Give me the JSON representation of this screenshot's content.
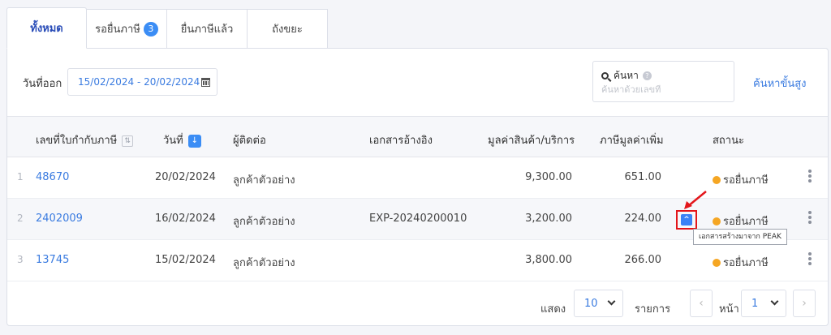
{
  "tabs": [
    {
      "label": "ทั้งหมด"
    },
    {
      "label": "รอยื่นภาษี",
      "badge": "3"
    },
    {
      "label": "ยื่นภาษีแล้ว"
    },
    {
      "label": "ถังขยะ"
    }
  ],
  "filter": {
    "date_label": "วันที่ออก",
    "date_range": "15/02/2024 - 20/02/2024"
  },
  "search": {
    "title": "ค้นหา",
    "help": "?",
    "placeholder": "ค้นหาด้วยเลขที่",
    "advanced_label": "ค้นหาขั้นสูง"
  },
  "table": {
    "headers": {
      "tax_invoice_no": "เลขที่ใบกำกับภาษี",
      "date": "วันที่",
      "contact": "ผู้ติดต่อ",
      "reference": "เอกสารอ้างอิง",
      "amount": "มูลค่าสินค้า/บริการ",
      "vat": "ภาษีมูลค่าเพิ่ม",
      "status": "สถานะ"
    },
    "rows": [
      {
        "index": "1",
        "doc_no": "48670",
        "date": "20/02/2024",
        "contact": "ลูกค้าตัวอย่าง",
        "reference": "",
        "amount": "9,300.00",
        "vat": "651.00",
        "status": "รอยื่นภาษี"
      },
      {
        "index": "2",
        "doc_no": "2402009",
        "date": "16/02/2024",
        "contact": "ลูกค้าตัวอย่าง",
        "reference": "EXP-20240200010",
        "amount": "3,200.00",
        "vat": "224.00",
        "status": "รอยื่นภาษี"
      },
      {
        "index": "3",
        "doc_no": "13745",
        "date": "15/02/2024",
        "contact": "ลูกค้าตัวอย่าง",
        "reference": "",
        "amount": "3,800.00",
        "vat": "266.00",
        "status": "รอยื่นภาษี"
      }
    ]
  },
  "tooltip": "เอกสารสร้างมาจาก PEAK",
  "pagination": {
    "show_label": "แสดง",
    "page_size": "10",
    "items_label": "รายการ",
    "page_label": "หน้า",
    "page": "1"
  },
  "colors": {
    "accent": "#3a7be0",
    "badge": "#3b8df5",
    "status_pending": "#f5a623",
    "highlight": "#e3161b"
  }
}
